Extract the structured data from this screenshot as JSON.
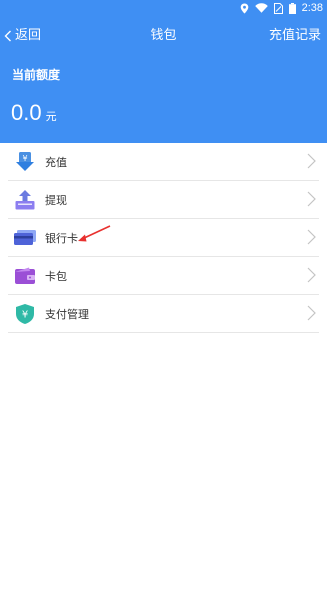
{
  "status_bar": {
    "time": "2:38",
    "icons": [
      "location-icon",
      "wifi-icon",
      "sim-icon",
      "battery-icon"
    ]
  },
  "nav": {
    "back_label": "返回",
    "title": "钱包",
    "records_label": "充值记录"
  },
  "balance": {
    "label": "当前额度",
    "amount": "0.0",
    "unit": "元"
  },
  "menu": {
    "items": [
      {
        "label": "充值",
        "icon": "recharge-icon"
      },
      {
        "label": "提现",
        "icon": "withdraw-icon"
      },
      {
        "label": "银行卡",
        "icon": "bank-card-icon"
      },
      {
        "label": "卡包",
        "icon": "card-wallet-icon"
      },
      {
        "label": "支付管理",
        "icon": "payment-shield-icon"
      }
    ]
  },
  "colors": {
    "header": "#3f8ff3",
    "annotation_arrow": "#e8312f"
  }
}
